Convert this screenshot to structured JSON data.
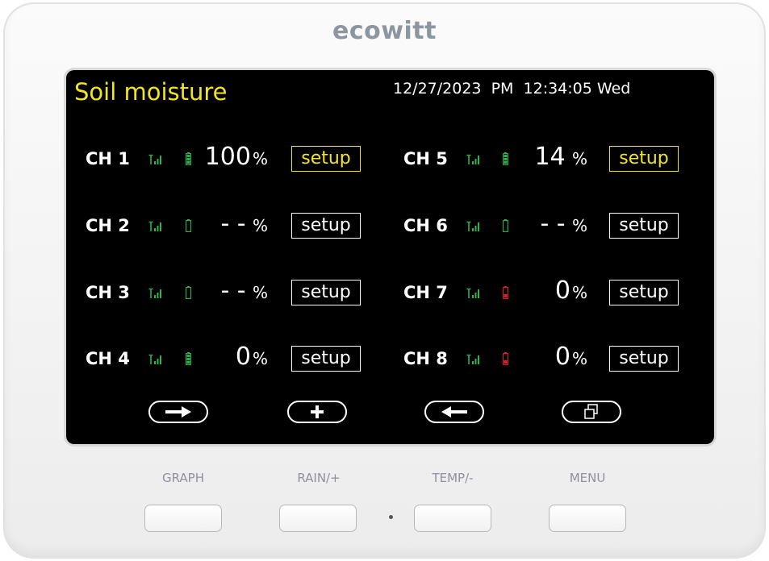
{
  "device": {
    "brand": "ecowitt"
  },
  "screen": {
    "title": "Soil moisture",
    "datetime": "12/27/2023  PM  12:34:05 Wed"
  },
  "channels": [
    {
      "label": "CH 1",
      "num": "100",
      "unit": "%",
      "battery": "full-green",
      "setup": "setup",
      "selected": true
    },
    {
      "label": "CH 2",
      "num": "- -",
      "unit": " %",
      "battery": "empty-green",
      "setup": "setup",
      "selected": false
    },
    {
      "label": "CH 3",
      "num": "- -",
      "unit": " %",
      "battery": "empty-green",
      "setup": "setup",
      "selected": false
    },
    {
      "label": "CH 4",
      "num": "0",
      "unit": "%",
      "battery": "full-green",
      "setup": "setup",
      "selected": false
    },
    {
      "label": "CH 5",
      "num": "14",
      "unit": " %",
      "battery": "full-green",
      "setup": "setup",
      "selected": true
    },
    {
      "label": "CH 6",
      "num": "- -",
      "unit": " %",
      "battery": "empty-green",
      "setup": "setup",
      "selected": false
    },
    {
      "label": "CH 7",
      "num": "0",
      "unit": "%",
      "battery": "low-red",
      "setup": "setup",
      "selected": false
    },
    {
      "label": "CH 8",
      "num": "0",
      "unit": "%",
      "battery": "low-red",
      "setup": "setup",
      "selected": false
    }
  ],
  "nav_buttons": [
    {
      "icon": "arrow-right-icon"
    },
    {
      "icon": "plus-icon"
    },
    {
      "icon": "arrow-left-icon"
    },
    {
      "icon": "pages-icon"
    }
  ],
  "hardware_buttons": [
    {
      "label": "GRAPH"
    },
    {
      "label": "RAIN/+"
    },
    {
      "label": "TEMP/-"
    },
    {
      "label": "MENU"
    }
  ],
  "colors": {
    "accent_yellow": "#f2e422",
    "signal_green": "#2fb34a",
    "battery_green": "#2fb34a",
    "battery_red": "#e0202a",
    "screen_bg": "#000000",
    "brand_gray": "#8c96a0"
  }
}
